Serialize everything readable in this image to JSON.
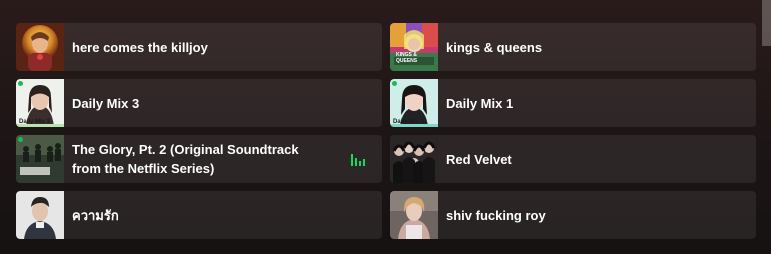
{
  "accent_color": "#1ed760",
  "cards": [
    {
      "title": "here comes the killjoy",
      "thumb_icon": "album-art-portrait-icon",
      "playing": false
    },
    {
      "title": "kings & queens",
      "thumb_icon": "album-art-collage-icon",
      "thumb_text": "KINGS & QUEENS",
      "playing": false
    },
    {
      "title": "Daily Mix 3",
      "thumb_icon": "daily-mix-cover-icon",
      "thumb_text": "Daily Mix 3",
      "playing": false
    },
    {
      "title": "Daily Mix 1",
      "thumb_icon": "daily-mix-cover-icon",
      "thumb_text": "Daily Mix 1",
      "playing": false
    },
    {
      "title": "The Glory, Pt. 2 (Original Soundtrack from the Netflix Series)",
      "thumb_icon": "soundtrack-cover-icon",
      "playing": true
    },
    {
      "title": "Red Velvet",
      "thumb_icon": "artist-group-photo-icon",
      "playing": false
    },
    {
      "title": "ความรัก",
      "thumb_icon": "artist-photo-icon",
      "playing": false
    },
    {
      "title": "shiv fucking roy",
      "thumb_icon": "playlist-cover-icon",
      "playing": false
    }
  ]
}
